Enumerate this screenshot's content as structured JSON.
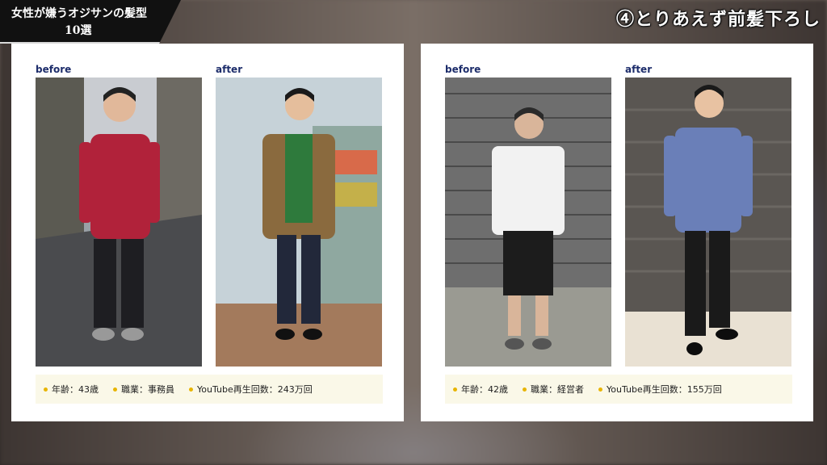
{
  "header": {
    "title_line1": "女性が嫌うオジサンの髪型",
    "title_line2": "10選",
    "section_title": "④とりあえず前髪下ろし"
  },
  "panels": [
    {
      "before_label": "before",
      "after_label": "after",
      "info": {
        "age": "年齢：43歳",
        "job": "職業：事務員",
        "views": "YouTube再生回数：243万回"
      }
    },
    {
      "before_label": "before",
      "after_label": "after",
      "info": {
        "age": "年齢：42歳",
        "job": "職業：経営者",
        "views": "YouTube再生回数：155万回"
      }
    }
  ],
  "colors": {
    "label": "#1d2d6b",
    "bullet": "#e8b400",
    "info_bg": "#faf8e8"
  }
}
